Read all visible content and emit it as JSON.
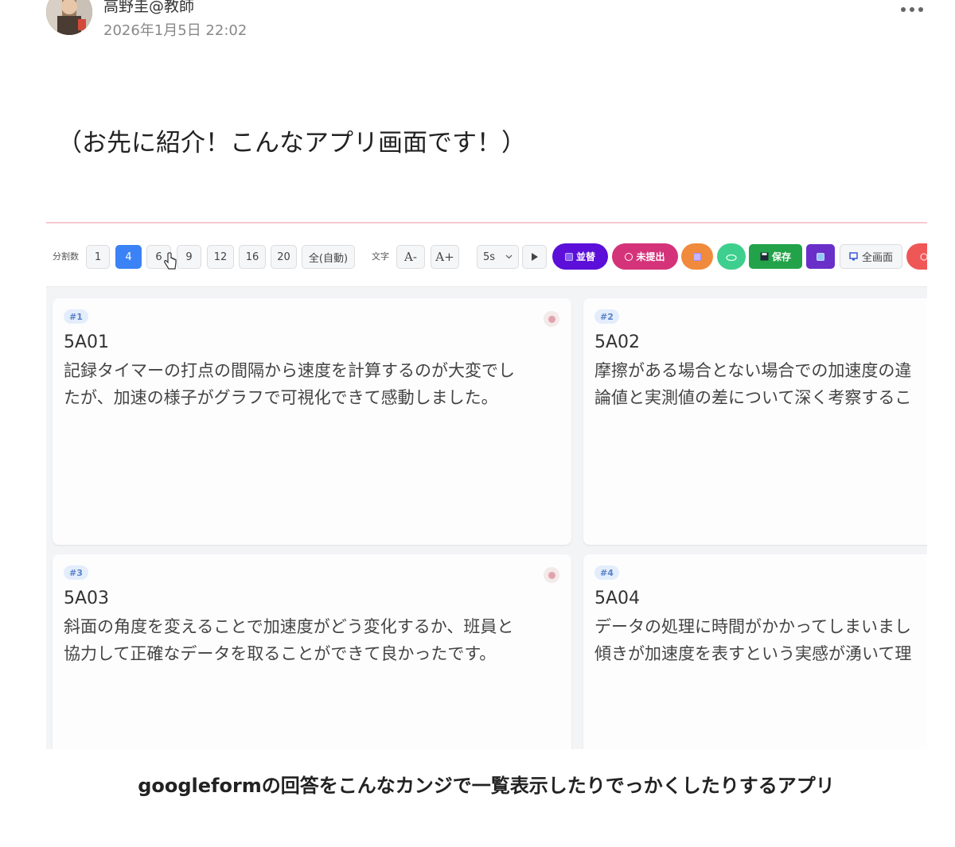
{
  "post": {
    "author": "高野圭@教師",
    "timestamp": "2026年1月5日 22:02",
    "intro": "（お先に紹介！こんなアプリ画面です！）",
    "caption": "googleformの回答をこんなカンジで一覧表示したりでっかくしたりするアプリ"
  },
  "app": {
    "toolbar": {
      "split_label": "分割数",
      "split_options": [
        "1",
        "4",
        "6",
        "9",
        "12",
        "16",
        "20",
        "全(自動)"
      ],
      "split_selected": "4",
      "text_label": "文字",
      "font_minus": "A-",
      "font_plus": "A+",
      "interval": "5s",
      "sort_label": "並替",
      "unsubmitted_label": "未提出",
      "save_label": "保存",
      "fullscreen_label": "全画面"
    },
    "cards": [
      {
        "badge": "#1",
        "id": "5A01",
        "lines": [
          "記録タイマーの打点の間隔から速度を計算するのが大変でし",
          "たが、加速の様子がグラフで可視化できて感動しました。"
        ]
      },
      {
        "badge": "#2",
        "id": "5A02",
        "lines": [
          "摩擦がある場合とない場合での加速度の違",
          "論値と実測値の差について深く考察するこ"
        ]
      },
      {
        "badge": "#3",
        "id": "5A03",
        "lines": [
          "斜面の角度を変えることで加速度がどう変化するか、班員と",
          "協力して正確なデータを取ることができて良かったです。"
        ]
      },
      {
        "badge": "#4",
        "id": "5A04",
        "lines": [
          "データの処理に時間がかかってしまいまし",
          "傾きが加速度を表すという実感が湧いて理"
        ]
      }
    ]
  },
  "colors": {
    "sort": "#5b0fd8",
    "unsubmitted": "#d4337a",
    "shuffle": "#f08a3c",
    "cloud": "#3ecf8e",
    "save": "#22a34a",
    "app": "#6b2fc9",
    "danger": "#ef5757",
    "selected": "#3b82f6"
  }
}
